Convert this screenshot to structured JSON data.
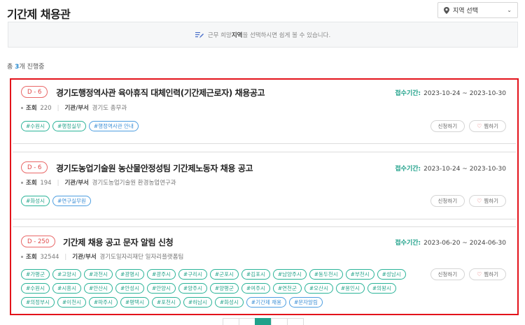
{
  "page_title": "기간제 채용관",
  "region_select": {
    "label": "지역 선택"
  },
  "notice": {
    "pre": "근무 희망 ",
    "bold": "지역",
    "post": "을 선택하시면 쉽게 볼 수 있습니다."
  },
  "count": {
    "pre": "총 ",
    "num": "3",
    "post": "개 진행중"
  },
  "period_label": "접수기간:",
  "views_label": "조회",
  "dept_label": "기관/부서",
  "apply_label": "신청하기",
  "like_label": "찜하기",
  "jobs": [
    {
      "dday": "D - 6",
      "title": "경기도행정역사관 육아휴직 대체인력(기간제근로자) 채용공고",
      "period": "2023-10-24 ~ 2023-10-30",
      "views": "220",
      "dept": "경기도 총무과",
      "tags": [
        {
          "text": "#수원시",
          "color": "green"
        },
        {
          "text": "#행정실무",
          "color": "green"
        },
        {
          "text": "#행정역사관 안내",
          "color": "blue"
        }
      ]
    },
    {
      "dday": "D - 6",
      "title": "경기도농업기술원 농산물안정성팀 기간제노동자 채용 공고",
      "period": "2023-10-24 ~ 2023-10-30",
      "views": "194",
      "dept": "경기도농업기술원 환경농업연구과",
      "tags": [
        {
          "text": "#화성시",
          "color": "green"
        },
        {
          "text": "#연구실무원",
          "color": "blue"
        }
      ]
    },
    {
      "dday": "D - 250",
      "title": "기간제 채용 공고 문자 알림 신청",
      "period": "2023-06-20 ~ 2024-06-30",
      "views": "32544",
      "dept": "경기도일자리재단 일자리플랫폼팀",
      "tags": [
        {
          "text": "#가평군",
          "color": "green"
        },
        {
          "text": "#고양시",
          "color": "green"
        },
        {
          "text": "#과천시",
          "color": "green"
        },
        {
          "text": "#광명시",
          "color": "green"
        },
        {
          "text": "#광주시",
          "color": "green"
        },
        {
          "text": "#구리시",
          "color": "green"
        },
        {
          "text": "#군포시",
          "color": "green"
        },
        {
          "text": "#김포시",
          "color": "green"
        },
        {
          "text": "#남양주시",
          "color": "green"
        },
        {
          "text": "#동두천시",
          "color": "green"
        },
        {
          "text": "#부천시",
          "color": "green"
        },
        {
          "text": "#성남시",
          "color": "green"
        },
        {
          "text": "#수원시",
          "color": "green"
        },
        {
          "text": "#시흥시",
          "color": "green"
        },
        {
          "text": "#안산시",
          "color": "green"
        },
        {
          "text": "#안성시",
          "color": "green"
        },
        {
          "text": "#안양시",
          "color": "green"
        },
        {
          "text": "#양주시",
          "color": "green"
        },
        {
          "text": "#양평군",
          "color": "green"
        },
        {
          "text": "#여주시",
          "color": "green"
        },
        {
          "text": "#연천군",
          "color": "green"
        },
        {
          "text": "#오산시",
          "color": "green"
        },
        {
          "text": "#용인시",
          "color": "green"
        },
        {
          "text": "#의왕시",
          "color": "green"
        },
        {
          "text": "#의정부시",
          "color": "green"
        },
        {
          "text": "#이천시",
          "color": "green"
        },
        {
          "text": "#파주시",
          "color": "green"
        },
        {
          "text": "#평택시",
          "color": "green"
        },
        {
          "text": "#포천시",
          "color": "green"
        },
        {
          "text": "#하남시",
          "color": "green"
        },
        {
          "text": "#화성시",
          "color": "green"
        },
        {
          "text": "#기간제 채용",
          "color": "blue"
        },
        {
          "text": "#문자알림",
          "color": "blue"
        }
      ]
    }
  ],
  "colors": {
    "accent": "#1fa18a",
    "dday": "#e04848",
    "highlight_frame": "#e3131b",
    "count": "#2a8bd0"
  }
}
